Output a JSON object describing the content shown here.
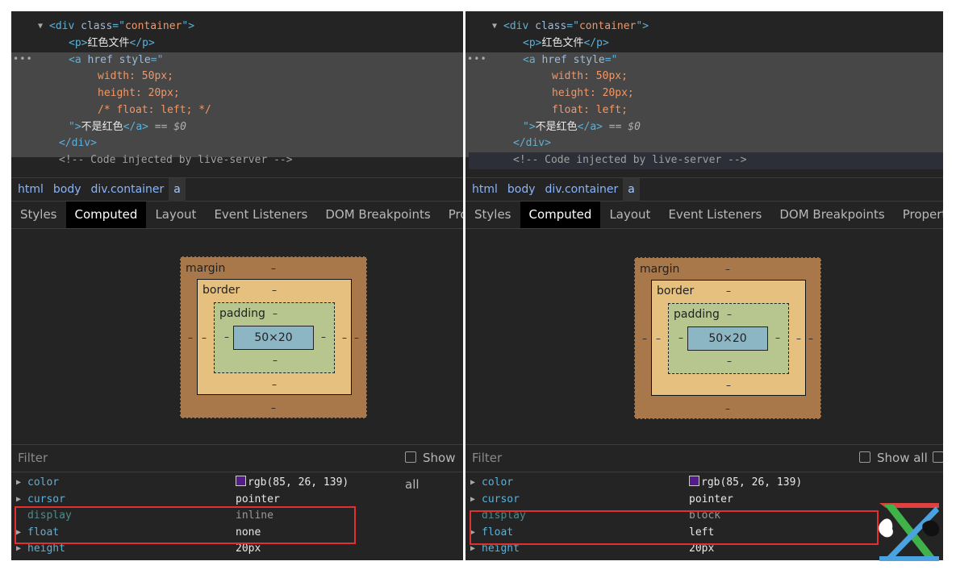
{
  "panels": [
    {
      "code_lines": [
        {
          "indent": 3,
          "tri": "▼",
          "parts": [
            [
              "tag",
              "<div "
            ],
            [
              "attr",
              "class"
            ],
            [
              "tag",
              "=\""
            ],
            [
              "val",
              "container"
            ],
            [
              "tag",
              "\">"
            ]
          ]
        },
        {
          "indent": 5,
          "parts": [
            [
              "tag",
              "<p>"
            ],
            [
              "txt",
              "红色文件"
            ],
            [
              "tag",
              "</p>"
            ]
          ]
        },
        {
          "indent": 5,
          "parts": [
            [
              "tag",
              "<a "
            ],
            [
              "attr",
              "href style"
            ],
            [
              "tag",
              "=\""
            ]
          ]
        },
        {
          "indent": 8,
          "parts": [
            [
              "val",
              "width: 50px;"
            ]
          ]
        },
        {
          "indent": 8,
          "parts": [
            [
              "val",
              "height: 20px;"
            ]
          ]
        },
        {
          "indent": 8,
          "parts": [
            [
              "val",
              "/* float: left; */"
            ]
          ]
        },
        {
          "indent": 5,
          "parts": [
            [
              "tag",
              "\">"
            ],
            [
              "txt",
              "不是红色"
            ],
            [
              "tag",
              "</a>"
            ],
            [
              "eq",
              " == "
            ],
            [
              "eq",
              "$0"
            ]
          ]
        },
        {
          "indent": 4,
          "parts": [
            [
              "tag",
              "</div>"
            ]
          ]
        },
        {
          "indent": 4,
          "parts": [
            [
              "cmt",
              "<!-- Code injected by live-server -->"
            ]
          ]
        }
      ],
      "breadcrumbs": [
        "html",
        "body",
        "div.container",
        "a"
      ],
      "tabs": [
        "Styles",
        "Computed",
        "Layout",
        "Event Listeners",
        "DOM Breakpoints",
        "Properties"
      ],
      "active_tab": "Computed",
      "box_model": {
        "margin": "margin",
        "border": "border",
        "padding": "padding",
        "content": "50×20",
        "dash": "–"
      },
      "filter_placeholder": "Filter",
      "show_all": "Show all",
      "properties": [
        {
          "name": "color",
          "value": "rgb(85, 26, 139)",
          "swatch": "#551a8b",
          "dim": false
        },
        {
          "name": "cursor",
          "value": "pointer",
          "dim": false
        },
        {
          "name": "display",
          "value": "inline",
          "dim": true
        },
        {
          "name": "float",
          "value": "none",
          "dim": false
        },
        {
          "name": "height",
          "value": "20px",
          "dim": false
        }
      ]
    },
    {
      "code_lines": [
        {
          "indent": 3,
          "tri": "▼",
          "parts": [
            [
              "tag",
              "<div "
            ],
            [
              "attr",
              "class"
            ],
            [
              "tag",
              "=\""
            ],
            [
              "val",
              "container"
            ],
            [
              "tag",
              "\">"
            ]
          ]
        },
        {
          "indent": 5,
          "parts": [
            [
              "tag",
              "<p>"
            ],
            [
              "txt",
              "红色文件"
            ],
            [
              "tag",
              "</p>"
            ]
          ]
        },
        {
          "indent": 5,
          "parts": [
            [
              "tag",
              "<a "
            ],
            [
              "attr",
              "href style"
            ],
            [
              "tag",
              "=\""
            ]
          ]
        },
        {
          "indent": 8,
          "parts": [
            [
              "val",
              "width: 50px;"
            ]
          ]
        },
        {
          "indent": 8,
          "parts": [
            [
              "val",
              "height: 20px;"
            ]
          ]
        },
        {
          "indent": 8,
          "parts": [
            [
              "val",
              "float: left;"
            ]
          ]
        },
        {
          "indent": 5,
          "parts": [
            [
              "tag",
              "\">"
            ],
            [
              "txt",
              "不是红色"
            ],
            [
              "tag",
              "</a>"
            ],
            [
              "eq",
              " == "
            ],
            [
              "eq",
              "$0"
            ]
          ]
        },
        {
          "indent": 4,
          "parts": [
            [
              "tag",
              "</div>"
            ]
          ]
        },
        {
          "indent": 4,
          "parts": [
            [
              "cmt",
              "<!-- Code injected by live-server -->"
            ]
          ]
        }
      ],
      "breadcrumbs": [
        "html",
        "body",
        "div.container",
        "a"
      ],
      "tabs": [
        "Styles",
        "Computed",
        "Layout",
        "Event Listeners",
        "DOM Breakpoints",
        "Properties"
      ],
      "active_tab": "Computed",
      "box_model": {
        "margin": "margin",
        "border": "border",
        "padding": "padding",
        "content": "50×20",
        "dash": "–"
      },
      "filter_placeholder": "Filter",
      "show_all": "Show all",
      "properties": [
        {
          "name": "color",
          "value": "rgb(85, 26, 139)",
          "swatch": "#551a8b",
          "dim": false
        },
        {
          "name": "cursor",
          "value": "pointer",
          "dim": false
        },
        {
          "name": "display",
          "value": "block",
          "dim": true
        },
        {
          "name": "float",
          "value": "left",
          "dim": false
        },
        {
          "name": "height",
          "value": "20px",
          "dim": false
        }
      ]
    }
  ],
  "highlight_color": "#e03030"
}
